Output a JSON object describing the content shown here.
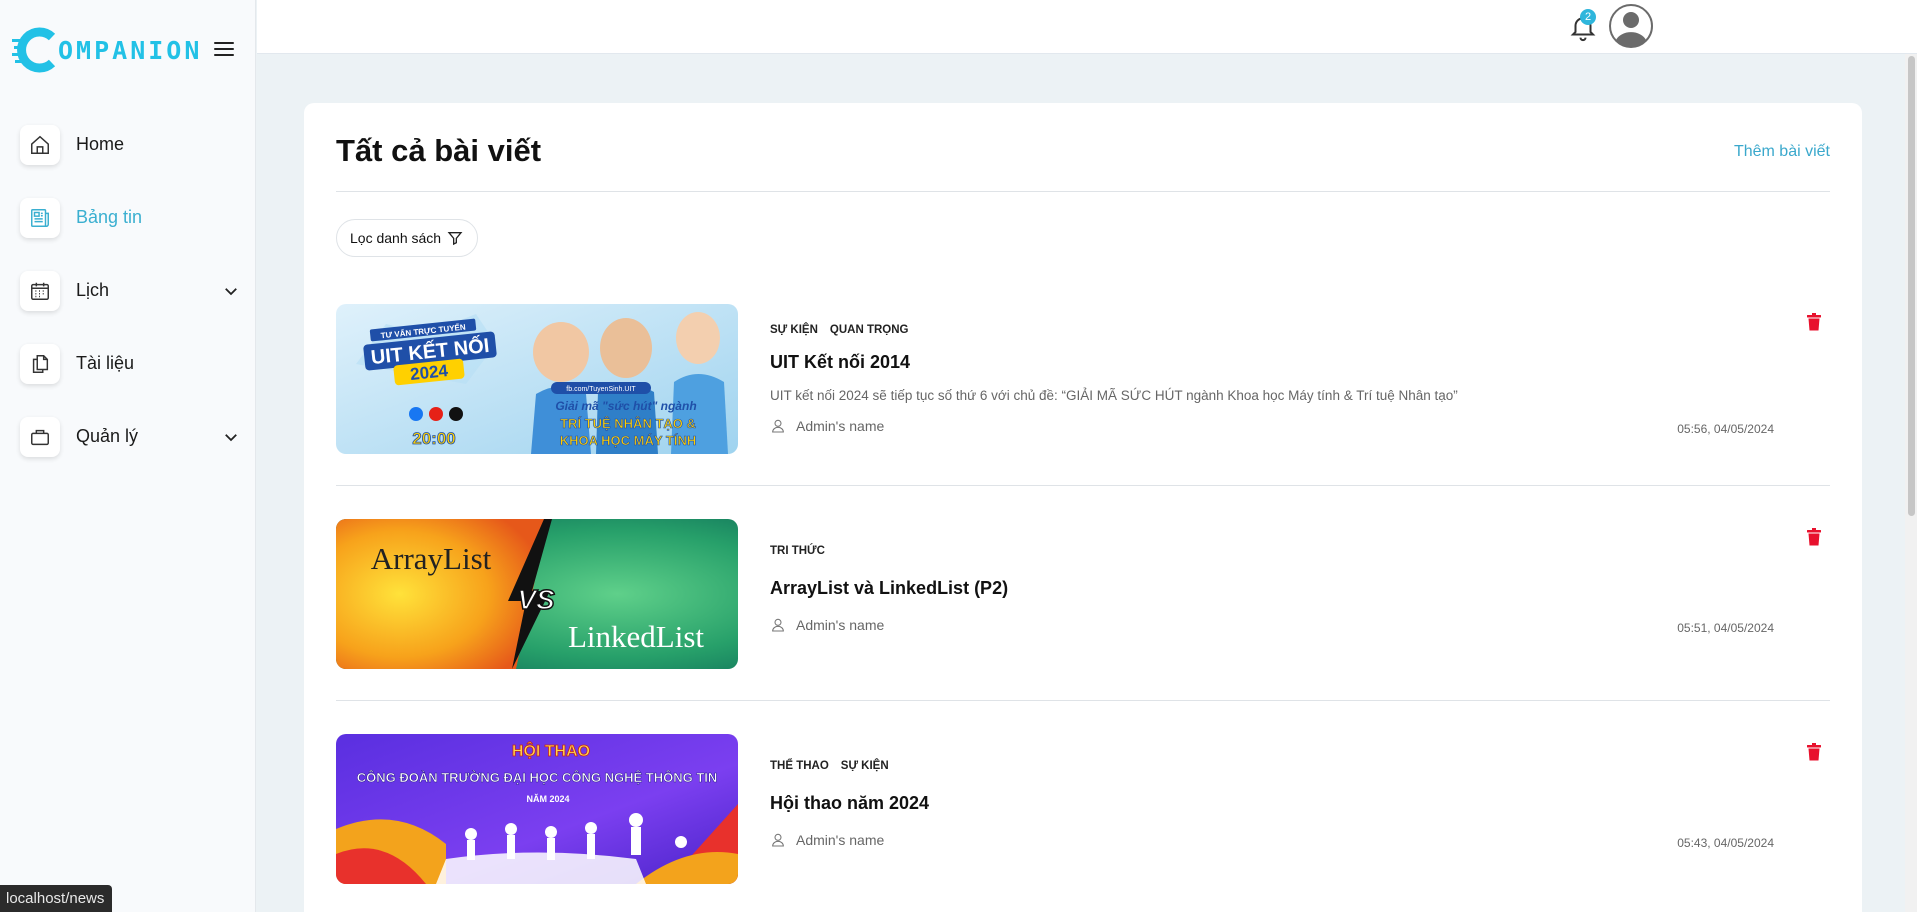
{
  "app": {
    "logo_text": "OMPANION"
  },
  "sidebar": {
    "items": [
      {
        "label": "Home",
        "icon": "home-icon",
        "active": false
      },
      {
        "label": "Bảng tin",
        "icon": "newspaper-icon",
        "active": true
      },
      {
        "label": "Lịch",
        "icon": "calendar-icon",
        "active": false,
        "expandable": true
      },
      {
        "label": "Tài liệu",
        "icon": "documents-icon",
        "active": false
      },
      {
        "label": "Quản lý",
        "icon": "briefcase-icon",
        "active": false,
        "expandable": true
      }
    ]
  },
  "header": {
    "notification_count": "2"
  },
  "page": {
    "title": "Tất cả bài viết",
    "add_post_label": "Thêm bài viết",
    "filter_label": "Lọc danh sách"
  },
  "posts": [
    {
      "tags": [
        "SỰ KIỆN",
        "QUAN TRỌNG"
      ],
      "title": "UIT Kết nối 2014",
      "description": "UIT kết nối 2024 sẽ tiếp tục số thứ 6 với chủ đề: “GIẢI MÃ SỨC HÚT ngành Khoa học Máy tính & Trí tuệ Nhân tạo”",
      "author": "Admin's name",
      "date": "05:56, 04/05/2024",
      "image": {
        "top_text": "TƯ VẤN TRỰC TUYẾN",
        "headline": "UIT KẾT NỐI",
        "year": "2024",
        "time": "20:00",
        "link": "fb.com/TuyenSinh.UIT",
        "slogan": "Giải mã \"sức hút\" ngành",
        "subject1": "TRÍ TUỆ NHÂN TẠO &",
        "subject2": "KHOA HỌC MÁY TÍNH"
      }
    },
    {
      "tags": [
        "TRI THỨC"
      ],
      "title": "ArrayList và LinkedList (P2)",
      "description": "",
      "author": "Admin's name",
      "date": "05:51, 04/05/2024",
      "image": {
        "left": "ArrayList",
        "vs": "VS",
        "right": "LinkedList"
      }
    },
    {
      "tags": [
        "THỂ THAO",
        "SỰ KIỆN"
      ],
      "title": "Hội thao năm 2024",
      "description": "",
      "author": "Admin's name",
      "date": "05:43, 04/05/2024",
      "image": {
        "top": "HỘI THAO",
        "middle": "CÔNG ĐOÀN TRƯỜNG ĐẠI HỌC CÔNG NGHỆ THÔNG TIN",
        "bottom": "NĂM 2024"
      }
    }
  ],
  "status_bar": {
    "url": "localhost/news"
  },
  "colors": {
    "accent": "#3aafd0",
    "danger": "#e8112d",
    "logo": "#22c1e6"
  }
}
